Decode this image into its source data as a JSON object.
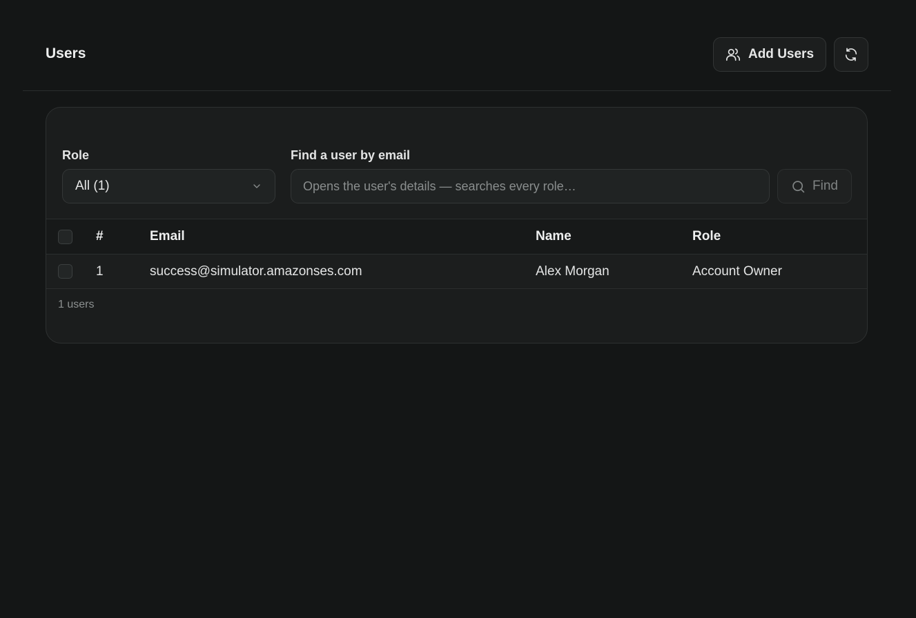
{
  "header": {
    "title": "Users",
    "add_users_label": "Add Users"
  },
  "filters": {
    "role_label": "Role",
    "role_selected": "All (1)",
    "search_label": "Find a user by email",
    "search_placeholder": "Opens the user's details — searches every role…",
    "search_value": "",
    "find_label": "Find"
  },
  "table": {
    "columns": [
      "#",
      "Email",
      "Name",
      "Role"
    ],
    "rows": [
      {
        "index": "1",
        "email": "success@simulator.amazonses.com",
        "name": "Alex Morgan",
        "role": "Account Owner"
      }
    ]
  },
  "footer": {
    "count_text": "1 users"
  },
  "icons": {
    "add_users": "users-icon",
    "refresh": "refresh-icon",
    "dropdown": "chevron-down-icon",
    "find": "search-icon"
  }
}
